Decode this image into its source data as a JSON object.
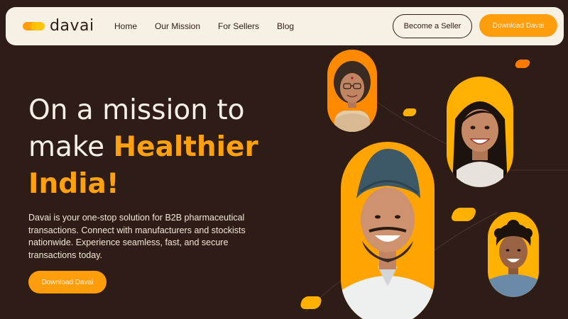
{
  "brand": {
    "name": "davai"
  },
  "nav": {
    "links": [
      "Home",
      "Our Mission",
      "For Sellers",
      "Blog"
    ],
    "become_seller": "Become a Seller",
    "download": "Download Davai"
  },
  "hero": {
    "title_line1": "On a mission to",
    "title_line2_plain": "make ",
    "title_highlight1": "Healthier",
    "title_highlight2": "India!",
    "description": "Davai is your one-stop solution for B2B pharmaceutical transactions. Connect with manufacturers and stockists nationwide. Experience seamless, fast, and secure transactions today.",
    "cta": "Download Davai"
  },
  "colors": {
    "background": "#2e1d16",
    "nav_bg": "#f7f0e4",
    "accent": "#ff9d0a",
    "highlight_text": "#ffa10e"
  },
  "portraits": [
    {
      "name": "elderly-woman-portrait",
      "bg": "#ff8a00"
    },
    {
      "name": "young-woman-portrait",
      "bg": "#ffb000"
    },
    {
      "name": "man-with-turban-portrait",
      "bg": "#ffa400"
    },
    {
      "name": "young-man-portrait",
      "bg": "#ffb100"
    }
  ]
}
